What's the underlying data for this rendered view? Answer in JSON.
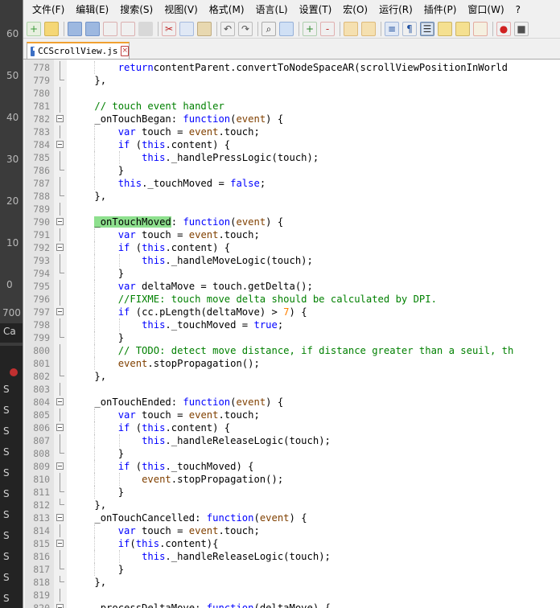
{
  "background_app": {
    "ruler_numbers": [
      "60",
      "50",
      "40",
      "30",
      "20",
      "10",
      "0",
      "700"
    ],
    "side_labels": [
      "Ca",
      "S",
      "S",
      "S",
      "S",
      "S",
      "S",
      "S",
      "S",
      "S",
      "S",
      "S"
    ]
  },
  "menu": [
    "文件(F)",
    "编辑(E)",
    "搜索(S)",
    "视图(V)",
    "格式(M)",
    "语言(L)",
    "设置(T)",
    "宏(O)",
    "运行(R)",
    "插件(P)",
    "窗口(W)",
    "?"
  ],
  "toolbar": {
    "icons": [
      "new-file-icon",
      "open-file-icon",
      "save-icon",
      "save-all-icon",
      "close-icon",
      "close-all-icon",
      "print-icon",
      "cut-icon",
      "copy-icon",
      "paste-icon",
      "undo-icon",
      "redo-icon",
      "find-icon",
      "replace-icon",
      "zoom-in-icon",
      "zoom-out-icon",
      "sync-vertical-icon",
      "sync-horizontal-icon",
      "word-wrap-icon",
      "show-all-chars-icon",
      "indent-guide-icon",
      "function-list-icon",
      "folder-workspace-icon",
      "document-map-icon",
      "record-macro-icon",
      "stop-record-icon"
    ]
  },
  "tab": {
    "filename": "CCScrollView.js"
  },
  "editor": {
    "lines": [
      {
        "n": "778",
        "indent": 2,
        "fold": "line",
        "tokens": [
          [
            "kw",
            "return"
          ],
          [
            "",
            "contentParent.convertToNodeSpaceAR(scrollViewPositionInWorld"
          ]
        ]
      },
      {
        "n": "779",
        "indent": 1,
        "fold": "end",
        "tokens": [
          [
            "",
            "},"
          ]
        ]
      },
      {
        "n": "780",
        "indent": 0,
        "fold": "line",
        "tokens": []
      },
      {
        "n": "781",
        "indent": 1,
        "fold": "line",
        "tokens": [
          [
            "cm",
            "// touch event handler"
          ]
        ]
      },
      {
        "n": "782",
        "indent": 1,
        "fold": "box",
        "tokens": [
          [
            "",
            "_onTouchBegan: "
          ],
          [
            "kw",
            "function"
          ],
          [
            "",
            "("
          ],
          [
            "ev",
            "event"
          ],
          [
            "",
            ") {"
          ]
        ]
      },
      {
        "n": "783",
        "indent": 2,
        "fold": "line",
        "tokens": [
          [
            "kw",
            "var"
          ],
          [
            "",
            " touch = "
          ],
          [
            "ev",
            "event"
          ],
          [
            "",
            ".touch;"
          ]
        ]
      },
      {
        "n": "784",
        "indent": 2,
        "fold": "box",
        "tokens": [
          [
            "kw",
            "if"
          ],
          [
            "",
            " ("
          ],
          [
            "kw",
            "this"
          ],
          [
            "",
            ".content) {"
          ]
        ]
      },
      {
        "n": "785",
        "indent": 3,
        "fold": "line",
        "tokens": [
          [
            "kw",
            "this"
          ],
          [
            "",
            "._handlePressLogic(touch);"
          ]
        ]
      },
      {
        "n": "786",
        "indent": 2,
        "fold": "end",
        "tokens": [
          [
            "",
            "}"
          ]
        ]
      },
      {
        "n": "787",
        "indent": 2,
        "fold": "line",
        "tokens": [
          [
            "kw",
            "this"
          ],
          [
            "",
            "._touchMoved = "
          ],
          [
            "kw",
            "false"
          ],
          [
            "",
            ";"
          ]
        ]
      },
      {
        "n": "788",
        "indent": 1,
        "fold": "end",
        "tokens": [
          [
            "",
            "},"
          ]
        ]
      },
      {
        "n": "789",
        "indent": 0,
        "fold": "line",
        "tokens": []
      },
      {
        "n": "790",
        "indent": 1,
        "fold": "box",
        "tokens": [
          [
            "hl",
            "_onTouchMoved"
          ],
          [
            "",
            ": "
          ],
          [
            "kw",
            "function"
          ],
          [
            "",
            "("
          ],
          [
            "ev",
            "event"
          ],
          [
            "",
            ") {"
          ]
        ]
      },
      {
        "n": "791",
        "indent": 2,
        "fold": "line",
        "tokens": [
          [
            "kw",
            "var"
          ],
          [
            "",
            " touch = "
          ],
          [
            "ev",
            "event"
          ],
          [
            "",
            ".touch;"
          ]
        ]
      },
      {
        "n": "792",
        "indent": 2,
        "fold": "box",
        "tokens": [
          [
            "kw",
            "if"
          ],
          [
            "",
            " ("
          ],
          [
            "kw",
            "this"
          ],
          [
            "",
            ".content) {"
          ]
        ]
      },
      {
        "n": "793",
        "indent": 3,
        "fold": "line",
        "tokens": [
          [
            "kw",
            "this"
          ],
          [
            "",
            "._handleMoveLogic(touch);"
          ]
        ]
      },
      {
        "n": "794",
        "indent": 2,
        "fold": "end",
        "tokens": [
          [
            "",
            "}"
          ]
        ]
      },
      {
        "n": "795",
        "indent": 2,
        "fold": "line",
        "tokens": [
          [
            "kw",
            "var"
          ],
          [
            "",
            " deltaMove = touch.getDelta();"
          ]
        ]
      },
      {
        "n": "796",
        "indent": 2,
        "fold": "line",
        "tokens": [
          [
            "cm",
            "//FIXME: touch move delta should be calculated by DPI."
          ]
        ]
      },
      {
        "n": "797",
        "indent": 2,
        "fold": "box",
        "tokens": [
          [
            "kw",
            "if"
          ],
          [
            "",
            " (cc.pLength(deltaMove) > "
          ],
          [
            "nm",
            "7"
          ],
          [
            "",
            ") {"
          ]
        ]
      },
      {
        "n": "798",
        "indent": 3,
        "fold": "line",
        "tokens": [
          [
            "kw",
            "this"
          ],
          [
            "",
            "._touchMoved = "
          ],
          [
            "kw",
            "true"
          ],
          [
            "",
            ";"
          ]
        ]
      },
      {
        "n": "799",
        "indent": 2,
        "fold": "end",
        "tokens": [
          [
            "",
            "}"
          ]
        ]
      },
      {
        "n": "800",
        "indent": 2,
        "fold": "line",
        "tokens": [
          [
            "cm",
            "// TODO: detect move distance, if distance greater than a seuil, th"
          ]
        ]
      },
      {
        "n": "801",
        "indent": 2,
        "fold": "line",
        "tokens": [
          [
            "ev",
            "event"
          ],
          [
            "",
            ".stopPropagation();"
          ]
        ]
      },
      {
        "n": "802",
        "indent": 1,
        "fold": "end",
        "tokens": [
          [
            "",
            "},"
          ]
        ]
      },
      {
        "n": "803",
        "indent": 0,
        "fold": "line",
        "tokens": []
      },
      {
        "n": "804",
        "indent": 1,
        "fold": "box",
        "tokens": [
          [
            "",
            "_onTouchEnded: "
          ],
          [
            "kw",
            "function"
          ],
          [
            "",
            "("
          ],
          [
            "ev",
            "event"
          ],
          [
            "",
            ") {"
          ]
        ]
      },
      {
        "n": "805",
        "indent": 2,
        "fold": "line",
        "tokens": [
          [
            "kw",
            "var"
          ],
          [
            "",
            " touch = "
          ],
          [
            "ev",
            "event"
          ],
          [
            "",
            ".touch;"
          ]
        ]
      },
      {
        "n": "806",
        "indent": 2,
        "fold": "box",
        "tokens": [
          [
            "kw",
            "if"
          ],
          [
            "",
            " ("
          ],
          [
            "kw",
            "this"
          ],
          [
            "",
            ".content) {"
          ]
        ]
      },
      {
        "n": "807",
        "indent": 3,
        "fold": "line",
        "tokens": [
          [
            "kw",
            "this"
          ],
          [
            "",
            "._handleReleaseLogic(touch);"
          ]
        ]
      },
      {
        "n": "808",
        "indent": 2,
        "fold": "end",
        "tokens": [
          [
            "",
            "}"
          ]
        ]
      },
      {
        "n": "809",
        "indent": 2,
        "fold": "box",
        "tokens": [
          [
            "kw",
            "if"
          ],
          [
            "",
            " ("
          ],
          [
            "kw",
            "this"
          ],
          [
            "",
            "._touchMoved) {"
          ]
        ]
      },
      {
        "n": "810",
        "indent": 3,
        "fold": "line",
        "tokens": [
          [
            "ev",
            "event"
          ],
          [
            "",
            ".stopPropagation();"
          ]
        ]
      },
      {
        "n": "811",
        "indent": 2,
        "fold": "end",
        "tokens": [
          [
            "",
            "}"
          ]
        ]
      },
      {
        "n": "812",
        "indent": 1,
        "fold": "end",
        "tokens": [
          [
            "",
            "},"
          ]
        ]
      },
      {
        "n": "813",
        "indent": 1,
        "fold": "box",
        "tokens": [
          [
            "",
            "_onTouchCancelled: "
          ],
          [
            "kw",
            "function"
          ],
          [
            "",
            "("
          ],
          [
            "ev",
            "event"
          ],
          [
            "",
            ") {"
          ]
        ]
      },
      {
        "n": "814",
        "indent": 2,
        "fold": "line",
        "tokens": [
          [
            "kw",
            "var"
          ],
          [
            "",
            " touch = "
          ],
          [
            "ev",
            "event"
          ],
          [
            "",
            ".touch;"
          ]
        ]
      },
      {
        "n": "815",
        "indent": 2,
        "fold": "box",
        "tokens": [
          [
            "kw",
            "if"
          ],
          [
            "",
            "("
          ],
          [
            "kw",
            "this"
          ],
          [
            "",
            ".content){"
          ]
        ]
      },
      {
        "n": "816",
        "indent": 3,
        "fold": "line",
        "tokens": [
          [
            "kw",
            "this"
          ],
          [
            "",
            "._handleReleaseLogic(touch);"
          ]
        ]
      },
      {
        "n": "817",
        "indent": 2,
        "fold": "end",
        "tokens": [
          [
            "",
            "}"
          ]
        ]
      },
      {
        "n": "818",
        "indent": 1,
        "fold": "end",
        "tokens": [
          [
            "",
            "},"
          ]
        ]
      },
      {
        "n": "819",
        "indent": 0,
        "fold": "line",
        "tokens": []
      },
      {
        "n": "820",
        "indent": 1,
        "fold": "box",
        "tokens": [
          [
            "",
            "_processDeltaMove: "
          ],
          [
            "kw",
            "function"
          ],
          [
            "",
            "(deltaMove) {"
          ]
        ]
      }
    ]
  },
  "colors": {
    "keyword": "#0000ff",
    "comment": "#008000",
    "event": "#804000",
    "number": "#ff8000",
    "highlight": "#8ee08e",
    "tab_accent": "#f0a030"
  }
}
